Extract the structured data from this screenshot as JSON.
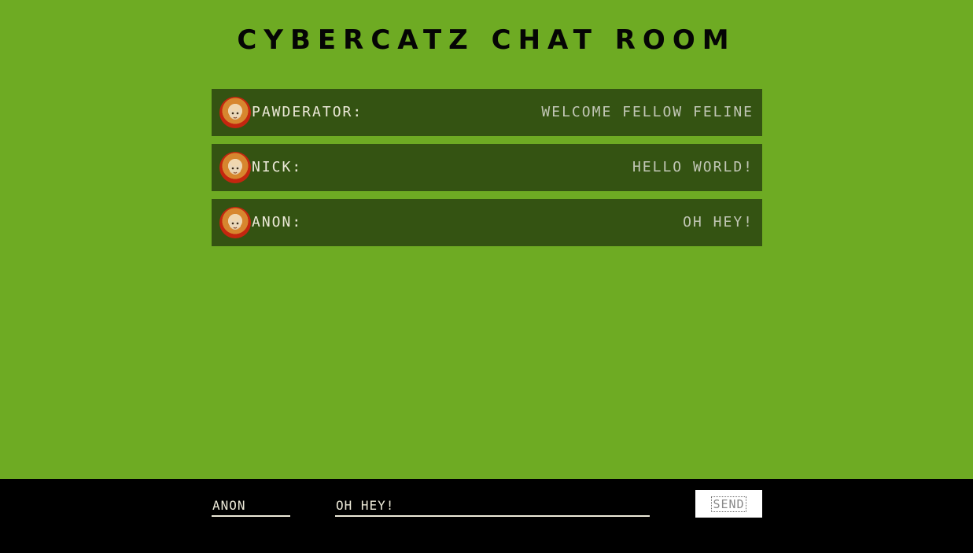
{
  "header": {
    "title": "Cybercatz Chat Room"
  },
  "messages": [
    {
      "author": "Pawderator:",
      "text": "Welcome fellow feline",
      "avatar_icon": "cat-avatar-icon"
    },
    {
      "author": "Nick:",
      "text": "Hello World!",
      "avatar_icon": "cat-avatar-icon"
    },
    {
      "author": "Anon:",
      "text": "Oh hey!",
      "avatar_icon": "cat-avatar-icon"
    }
  ],
  "composer": {
    "name_value": "ANON",
    "message_value": "OH HEY!",
    "send_label": "SEND"
  },
  "colors": {
    "background": "#6eab23",
    "message_bg": "#345312",
    "footer_bg": "#000000"
  }
}
